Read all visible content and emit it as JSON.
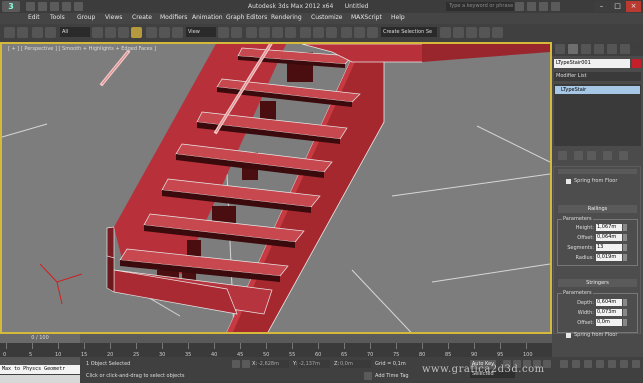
{
  "app": {
    "title": "Autodesk 3ds Max 2012 x64",
    "doc": "Untitled"
  },
  "search": {
    "placeholder": "Type a keyword or phrase"
  },
  "window_buttons": [
    "–",
    "□",
    "×"
  ],
  "menu": {
    "items": [
      "Edit",
      "Tools",
      "Group",
      "Views",
      "Create",
      "Modifiers",
      "Animation",
      "Graph Editors",
      "Rendering",
      "Customize",
      "MAXScript",
      "Help"
    ]
  },
  "toolbar": {
    "selection_filter": "All",
    "ref_coord": "View",
    "named_selection": "Create Selection Se"
  },
  "viewport": {
    "label": "[ + ] [ Perspective ] [ Smooth + Highlights + Edged Faces ]"
  },
  "command_panel": {
    "object_name": "LTypeStair001",
    "object_color": "#c41f2a",
    "modifier_list": "Modifier List",
    "stack_item": "LTypeStair",
    "railings": {
      "title": "Railings",
      "group_title": "Parameters",
      "spring_from_floor": "Spring from Floor",
      "fields": [
        {
          "label": "Height:",
          "value": "1,067m"
        },
        {
          "label": "Offset:",
          "value": "0,064m"
        },
        {
          "label": "Segments:",
          "value": "13"
        },
        {
          "label": "Radius:",
          "value": "0,019m"
        }
      ]
    },
    "stringers": {
      "title": "Stringers",
      "group_title": "Parameters",
      "fields": [
        {
          "label": "Depth:",
          "value": "0,604m"
        },
        {
          "label": "Width:",
          "value": "0,073m"
        },
        {
          "label": "Offset:",
          "value": "0,0m"
        }
      ],
      "spring_from_floor": "Spring from Floor"
    }
  },
  "timeline": {
    "frame_display": "0 / 100",
    "ticks": [
      "0",
      "5",
      "10",
      "15",
      "20",
      "25",
      "30",
      "35",
      "40",
      "45",
      "50",
      "55",
      "60",
      "65",
      "70",
      "75",
      "80",
      "85",
      "90",
      "95",
      "100"
    ]
  },
  "status": {
    "maxscript_text": "Max to Physcs Geometr",
    "selected": "1 Object Selected",
    "prompt": "Click or click-and-drag to select objects",
    "x": "-2,628m",
    "y": "-2,137m",
    "z": "0,0m",
    "grid": "Grid = 0,1m",
    "add_time_tag": "Add Time Tag",
    "auto_key": "Auto Key",
    "selected_drop": "Selected",
    "set_key": "Set Key",
    "key_filters": "Key Filters..."
  },
  "watermark": "www.grafica2d3d.com",
  "colors": {
    "stair_red": "#b8303a",
    "stair_dark": "#5a1214",
    "viewport_bg": "#7d7d7d",
    "active_border": "#d4b93b",
    "selection_highlight": "#a6c8e6"
  }
}
